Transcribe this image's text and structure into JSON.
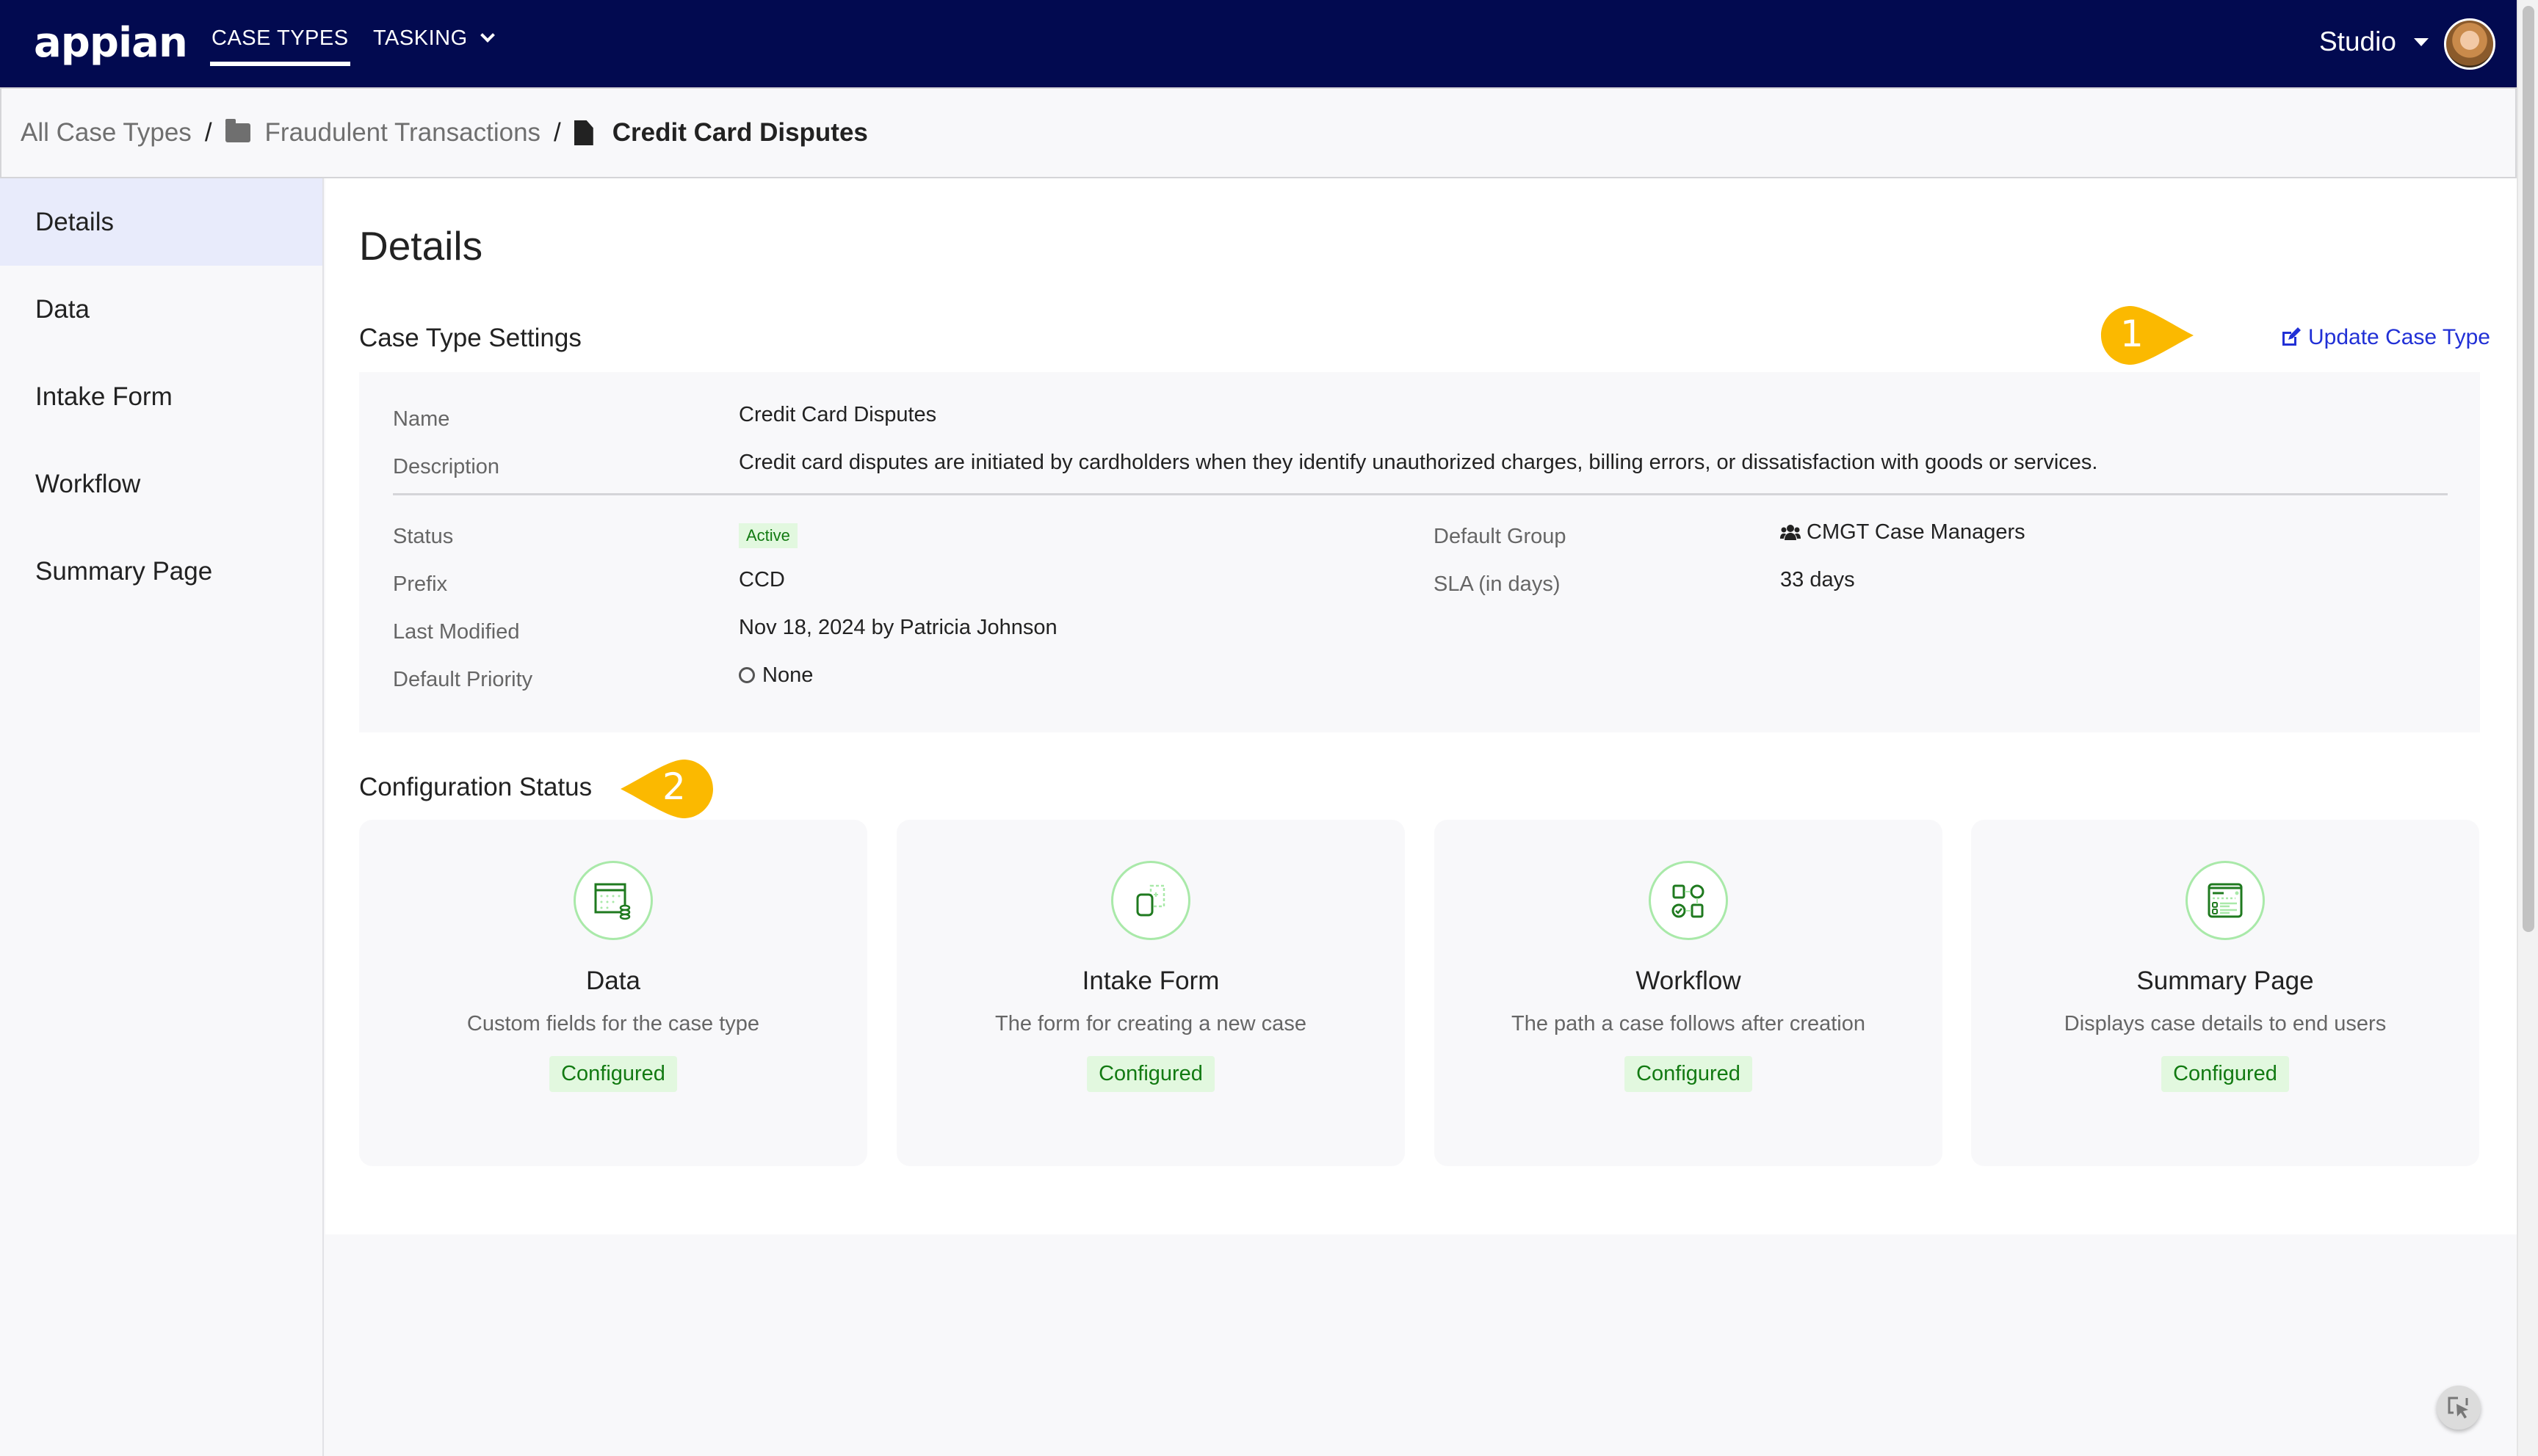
{
  "header": {
    "logo": "appian",
    "nav": [
      {
        "label": "CASE TYPES",
        "active": true
      },
      {
        "label": "TASKING",
        "has_dropdown": true
      }
    ],
    "studio_label": "Studio",
    "avatar": "user-avatar"
  },
  "breadcrumb": {
    "items": [
      {
        "label": "All Case Types",
        "icon": null
      },
      {
        "label": "Fraudulent Transactions",
        "icon": "folder-icon"
      },
      {
        "label": "Credit Card Disputes",
        "icon": "file-icon",
        "current": true
      }
    ],
    "separator": "/"
  },
  "sidebar": {
    "items": [
      {
        "label": "Details",
        "active": true
      },
      {
        "label": "Data"
      },
      {
        "label": "Intake Form"
      },
      {
        "label": "Workflow"
      },
      {
        "label": "Summary Page"
      }
    ]
  },
  "main": {
    "title": "Details",
    "settings": {
      "title": "Case Type Settings",
      "update_label": "Update Case Type",
      "name_label": "Name",
      "name_value": "Credit Card Disputes",
      "description_label": "Description",
      "description_value": "Credit card disputes are initiated by cardholders when they identify unauthorized charges, billing errors, or dissatisfaction with goods or services.",
      "status_label": "Status",
      "status_value": "Active",
      "prefix_label": "Prefix",
      "prefix_value": "CCD",
      "last_modified_label": "Last Modified",
      "last_modified_value": "Nov 18, 2024 by Patricia Johnson",
      "default_priority_label": "Default Priority",
      "default_priority_value": "None",
      "default_group_label": "Default Group",
      "default_group_value": "CMGT Case Managers",
      "sla_label": "SLA (in days)",
      "sla_value": "33 days"
    },
    "config": {
      "title": "Configuration Status",
      "cards": [
        {
          "title": "Data",
          "description": "Custom fields for the case type",
          "status": "Configured",
          "icon": "data-table-icon"
        },
        {
          "title": "Intake Form",
          "description": "The form for creating a new case",
          "status": "Configured",
          "icon": "intake-form-icon"
        },
        {
          "title": "Workflow",
          "description": "The path a case follows after creation",
          "status": "Configured",
          "icon": "workflow-icon"
        },
        {
          "title": "Summary Page",
          "description": "Displays case details to end users",
          "status": "Configured",
          "icon": "summary-page-icon"
        }
      ]
    }
  },
  "annotations": [
    {
      "number": "1"
    },
    {
      "number": "2"
    }
  ],
  "colors": {
    "header_bg": "#020a50",
    "link": "#2130d6",
    "callout": "#fbb900",
    "success_bg": "#e2f8df",
    "success_text": "#127a12",
    "sidebar_active": "#e8ebfb"
  }
}
